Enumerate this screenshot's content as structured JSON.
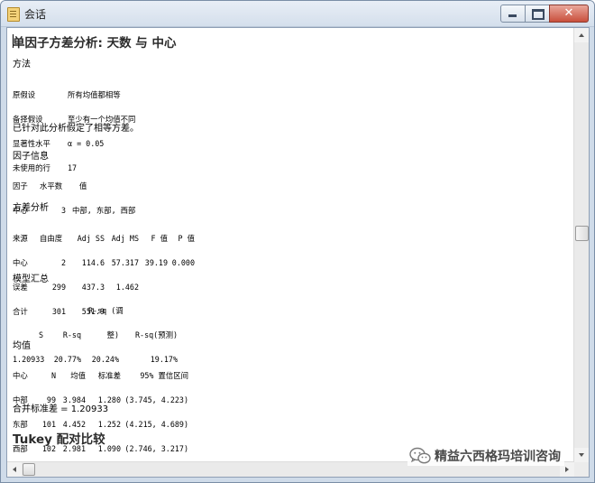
{
  "window": {
    "title": "会话",
    "buttons": {
      "minimize": "minimize",
      "maximize": "maximize",
      "close": "✕"
    }
  },
  "report": {
    "title": "单因子方差分析: 天数 与 中心",
    "method": {
      "heading": "方法",
      "rows": [
        {
          "label": "原假设",
          "value": "所有均值都相等"
        },
        {
          "label": "备择假设",
          "value": "至少有一个均值不同"
        },
        {
          "label": "显著性水平",
          "value": "α = 0.05"
        },
        {
          "label": "未使用的行",
          "value": "17"
        }
      ],
      "note": "已针对此分析假定了相等方差。"
    },
    "factor_info": {
      "heading": "因子信息",
      "headers": [
        "因子",
        "水平数",
        "值"
      ],
      "row": [
        "中心",
        "3",
        "中部, 东部, 西部"
      ]
    },
    "anova": {
      "heading": "方差分析",
      "headers": [
        "来源",
        "自由度",
        "Adj SS",
        "Adj MS",
        "F 值",
        "P 值"
      ],
      "rows": [
        [
          "中心",
          "2",
          "114.6",
          "57.317",
          "39.19",
          "0.000"
        ],
        [
          "误差",
          "299",
          "437.3",
          "1.462",
          "",
          ""
        ],
        [
          "合计",
          "301",
          "551.9",
          "",
          "",
          ""
        ]
      ]
    },
    "model_summary": {
      "heading": "模型汇总",
      "header_line1": "R-sq (调",
      "headers": [
        "S",
        "R-sq",
        "整)",
        "R-sq(预测)"
      ],
      "row": [
        "1.20933",
        "20.77%",
        "20.24%",
        "19.17%"
      ]
    },
    "means": {
      "heading": "均值",
      "headers": [
        "中心",
        "N",
        "均值",
        "标准差",
        "95% 置信区间"
      ],
      "rows": [
        [
          "中部",
          "99",
          "3.984",
          "1.280",
          "(3.745, 4.223)"
        ],
        [
          "东部",
          "101",
          "4.452",
          "1.252",
          "(4.215, 4.689)"
        ],
        [
          "西部",
          "102",
          "2.981",
          "1.090",
          "(2.746, 3.217)"
        ]
      ],
      "pooled": "合并标准差 = 1.20933"
    },
    "tukey_heading": "Tukey 配对比较"
  },
  "watermark": {
    "text": "精益六西格玛培训咨询"
  },
  "icons": {
    "window_icon": "document-icon",
    "watermark_logo": "wechat-logo-icon"
  }
}
